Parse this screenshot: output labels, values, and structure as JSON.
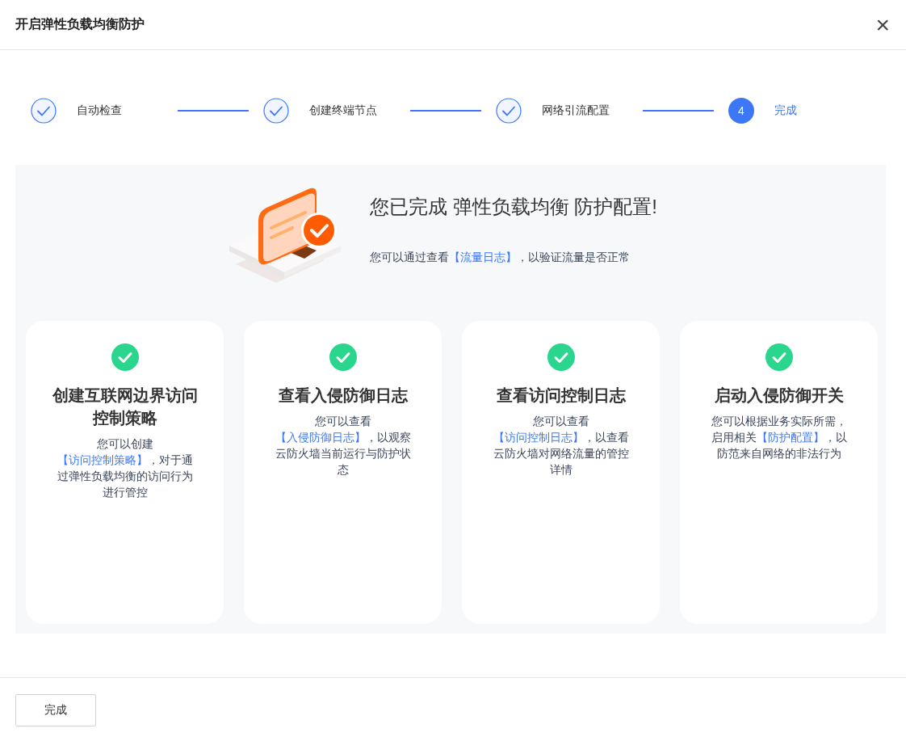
{
  "dialog": {
    "title": "开启弹性负载均衡防护",
    "close": "×"
  },
  "steps": [
    {
      "label": "自动检查",
      "kind": "done"
    },
    {
      "label": "创建终端节点",
      "kind": "done"
    },
    {
      "label": "网络引流配置",
      "kind": "done"
    },
    {
      "label": "完成",
      "kind": "current",
      "number": "4"
    }
  ],
  "result": {
    "title": "您已完成 弹性负载均衡 防护配置!",
    "hint": {
      "before": "您可以通过查看",
      "link": "【流量日志】",
      "after": "，以验证流量是否正常"
    }
  },
  "cards": [
    {
      "title": "创建互联网边界访问控制策略",
      "before": "您可以创建",
      "link": "【访问控制策略】",
      "after": "，对于通过弹性负载均衡的访问行为进行管控"
    },
    {
      "title": "查看入侵防御日志",
      "before": "您可以查看",
      "link": "【入侵防御日志】",
      "after": "，以观察云防火墙当前运行与防护状态"
    },
    {
      "title": "查看访问控制日志",
      "before": "您可以查看",
      "link": "【访问控制日志】",
      "after": "，以查看云防火墙对网络流量的管控详情"
    },
    {
      "title": "启动入侵防御开关",
      "before": "您可以根据业务实际所需，启用相关",
      "link": "【防护配置】",
      "after": "，以防范来自网络的非法行为"
    }
  ],
  "footer": {
    "button": "完成"
  }
}
